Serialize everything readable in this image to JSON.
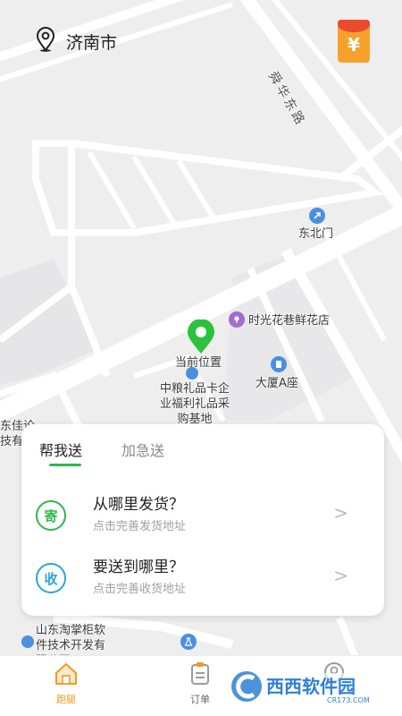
{
  "header": {
    "city": "济南市",
    "location_icon": "location-pin-icon",
    "promo_icon": "red-packet-icon",
    "promo_symbol": "¥"
  },
  "map": {
    "road_label": "舜华东路",
    "pois": {
      "north_gate": "东北门",
      "flower_shop": "时光花巷鲜花店",
      "current_location": "当前位置",
      "gift_base": "中粮礼品卡企业福利礼品采购基地",
      "building_a": "大厦A座",
      "left_cut_top": "东佳论",
      "left_cut_bottom": "技有",
      "software_co": "山东淘掌柜软件技术开发有限公司"
    }
  },
  "panel": {
    "tabs": [
      {
        "label": "帮我送",
        "active": true
      },
      {
        "label": "加急送",
        "active": false
      }
    ],
    "rows": [
      {
        "badge": "寄",
        "title": "从哪里发货？",
        "subtitle": "点击完善发货地址",
        "color": "#2db84d"
      },
      {
        "badge": "收",
        "title": "要送到哪里？",
        "subtitle": "点击完善收货地址",
        "color": "#2aa7d8"
      }
    ],
    "chevron": ">"
  },
  "tabbar": {
    "items": [
      {
        "label": "跑腿",
        "icon": "house-icon",
        "active": true
      },
      {
        "label": "订单",
        "icon": "order-list-icon",
        "active": false
      }
    ]
  },
  "watermark": {
    "logo_text": "西西软件园",
    "domain": "CR173.COM"
  },
  "colors": {
    "accent_green": "#2db84d",
    "accent_orange": "#f7a12d",
    "map_bg": "#eeeeef",
    "road": "#ffffff"
  }
}
